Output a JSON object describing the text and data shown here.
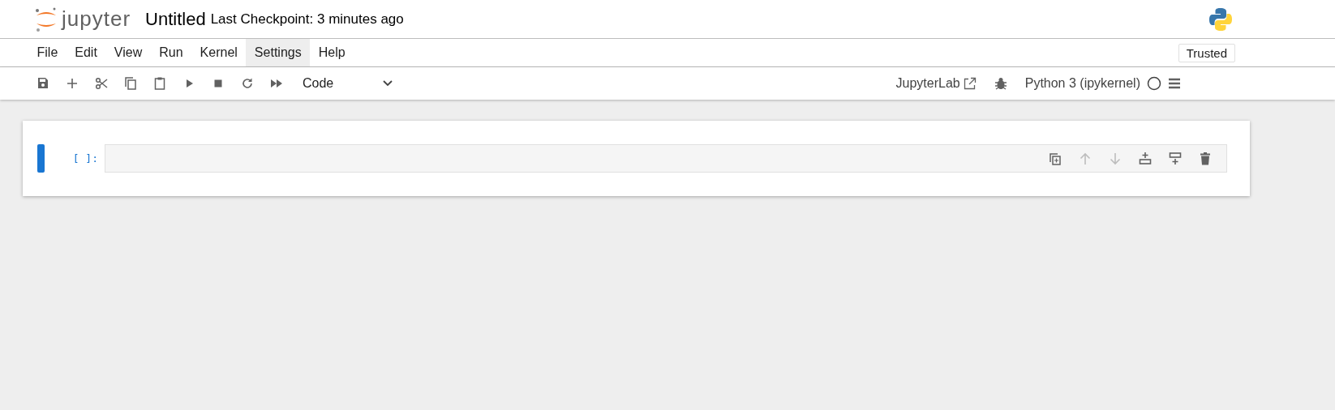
{
  "header": {
    "logo_text": "jupyter",
    "title": "Untitled",
    "checkpoint": "Last Checkpoint: 3 minutes ago"
  },
  "menu": [
    {
      "label": "File",
      "selected": false
    },
    {
      "label": "Edit",
      "selected": false
    },
    {
      "label": "View",
      "selected": false
    },
    {
      "label": "Run",
      "selected": false
    },
    {
      "label": "Kernel",
      "selected": false
    },
    {
      "label": "Settings",
      "selected": true
    },
    {
      "label": "Help",
      "selected": false
    }
  ],
  "trusted": "Trusted",
  "toolbar": {
    "tools": [
      {
        "kind": "save"
      },
      {
        "kind": "add"
      },
      {
        "kind": "cut"
      },
      {
        "kind": "copy"
      },
      {
        "kind": "paste"
      },
      {
        "kind": "run"
      },
      {
        "kind": "stop"
      },
      {
        "kind": "restart"
      },
      {
        "kind": "run-all"
      }
    ],
    "cell_type": "Code",
    "jupyterlab": "JupyterLab",
    "kernel": "Python 3 (ipykernel)",
    "kernel_busy": false
  },
  "cells": [
    {
      "active": true,
      "prompt": "[ ]:",
      "tools": [
        {
          "kind": "duplicate",
          "disabled": false
        },
        {
          "kind": "up",
          "disabled": true
        },
        {
          "kind": "down",
          "disabled": true
        },
        {
          "kind": "insert-above",
          "disabled": false
        },
        {
          "kind": "insert-below",
          "disabled": false
        },
        {
          "kind": "delete",
          "disabled": false
        }
      ]
    }
  ]
}
